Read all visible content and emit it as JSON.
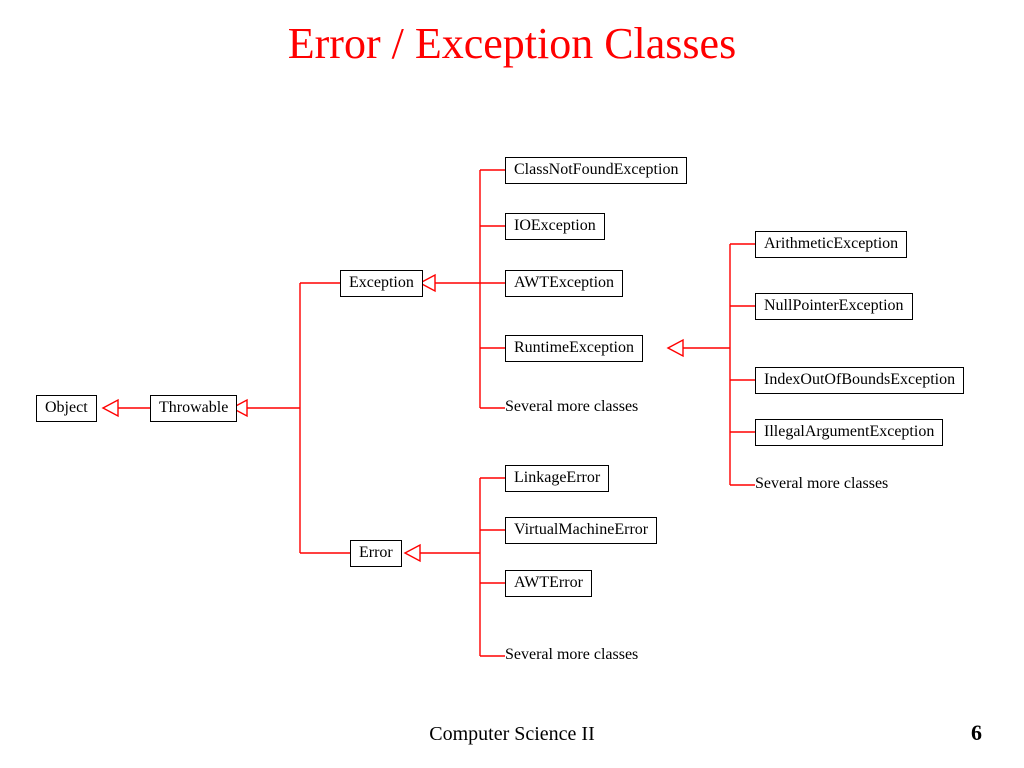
{
  "title": "Error / Exception Classes",
  "footer": {
    "course": "Computer Science II",
    "page": "6"
  },
  "nodes": {
    "object": "Object",
    "throwable": "Throwable",
    "exception": "Exception",
    "error": "Error",
    "classNotFound": "ClassNotFoundException",
    "io": "IOException",
    "awtException": "AWTException",
    "runtime": "RuntimeException",
    "exceptionMore": "Several more classes",
    "linkage": "LinkageError",
    "vmError": "VirtualMachineError",
    "awtError": "AWTError",
    "errorMore": "Several more classes",
    "arithmetic": "ArithmeticException",
    "nullPointer": "NullPointerException",
    "indexOOB": "IndexOutOfBoundsException",
    "illegalArg": "IllegalArgumentException",
    "runtimeMore": "Several more classes"
  }
}
